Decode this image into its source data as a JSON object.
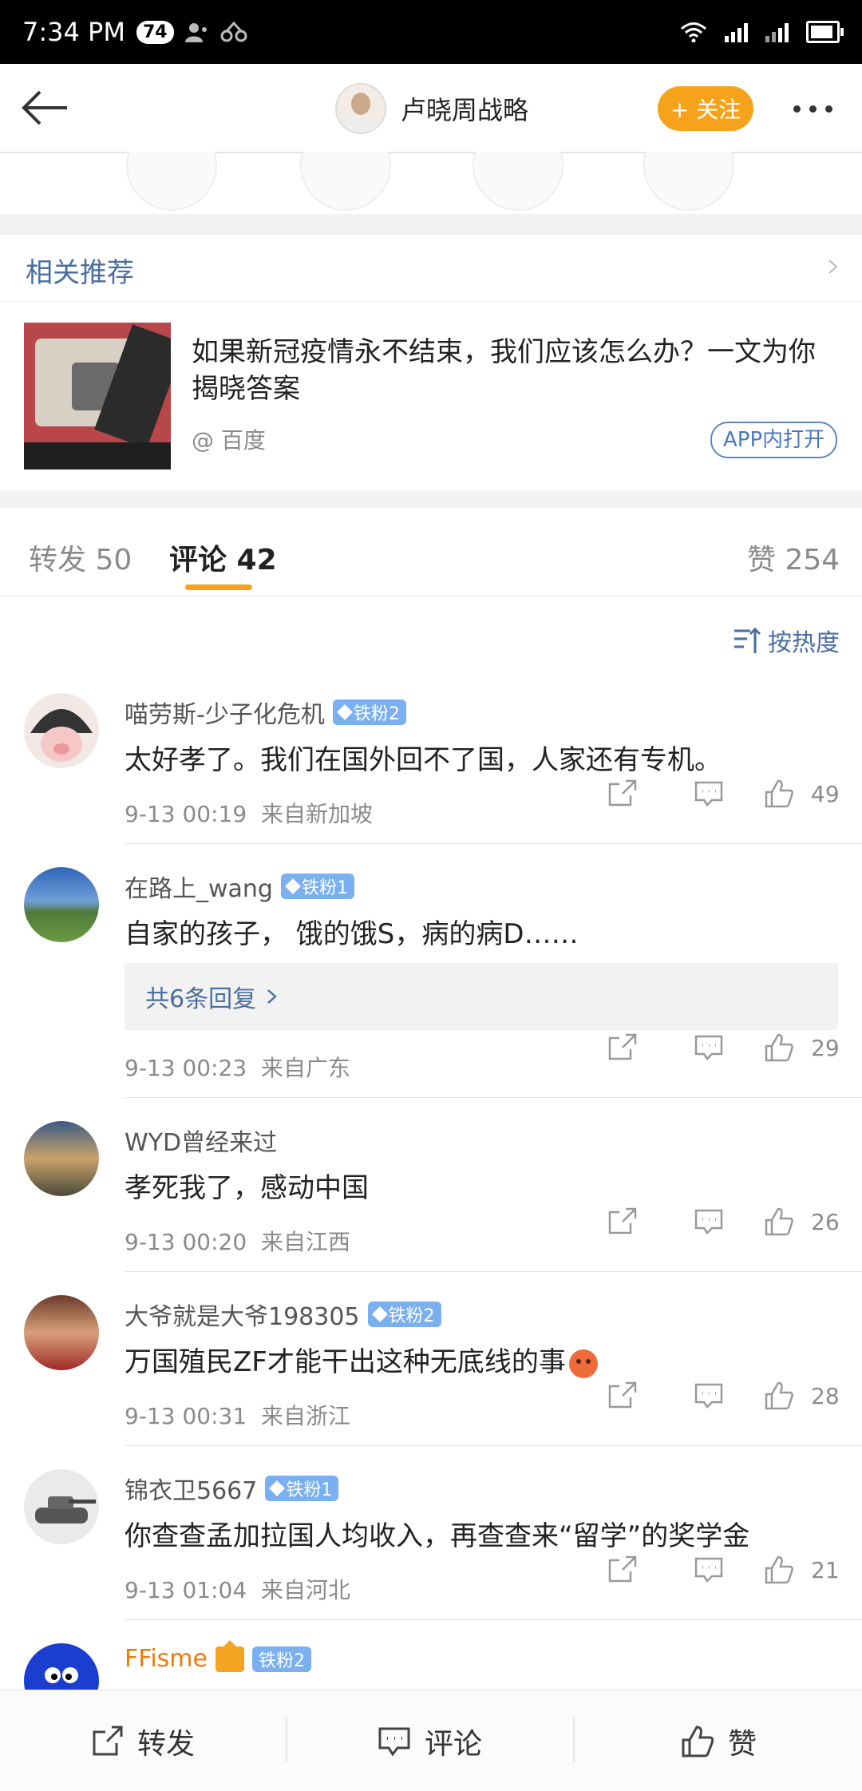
{
  "status_bar": {
    "time": "7:34 PM",
    "badge": "74"
  },
  "header": {
    "author_name": "卢晓周战略",
    "follow_label": "+ 关注"
  },
  "related": {
    "title": "相关推荐",
    "article_title": "如果新冠疫情永不结束，我们应该怎么办？一文为你揭晓答案",
    "source": "@ 百度",
    "app_button": "APP内打开"
  },
  "tabs": {
    "repost": "转发 50",
    "comments": "评论 42",
    "likes": "赞 254"
  },
  "sort_label": "按热度",
  "comments": [
    {
      "name": "喵劳斯-少子化危机",
      "badge": "铁粉2",
      "text": "太好孝了。我们在国外回不了国，人家还有专机。",
      "time": "9-13 00:19",
      "location": "来自新加坡",
      "likes": "49"
    },
    {
      "name": "在路上_wang",
      "badge": "铁粉1",
      "text": "自家的孩子， 饿的饿S，病的病D……",
      "replies": "共6条回复",
      "time": "9-13 00:23",
      "location": "来自广东",
      "likes": "29"
    },
    {
      "name": "WYD曾经来过",
      "text": "孝死我了，感动中国",
      "time": "9-13 00:20",
      "location": "来自江西",
      "likes": "26"
    },
    {
      "name": "大爷就是大爷198305",
      "badge": "铁粉2",
      "text": "万国殖民ZF才能干出这种无底线的事",
      "time": "9-13 00:31",
      "location": "来自浙江",
      "likes": "28"
    },
    {
      "name": "锦衣卫5667",
      "badge": "铁粉1",
      "text": "你查查孟加拉国人均收入，再查查来“留学”的奖学金",
      "time": "9-13 01:04",
      "location": "来自河北",
      "likes": "21"
    },
    {
      "name": "FFisme",
      "badge": "铁粉2"
    }
  ],
  "bottom_bar": {
    "repost": "转发",
    "comment": "评论",
    "like": "赞"
  },
  "colors": {
    "accent": "#f7a21b",
    "link": "#4a6ea0",
    "fan_badge": "#7ab0ef"
  }
}
